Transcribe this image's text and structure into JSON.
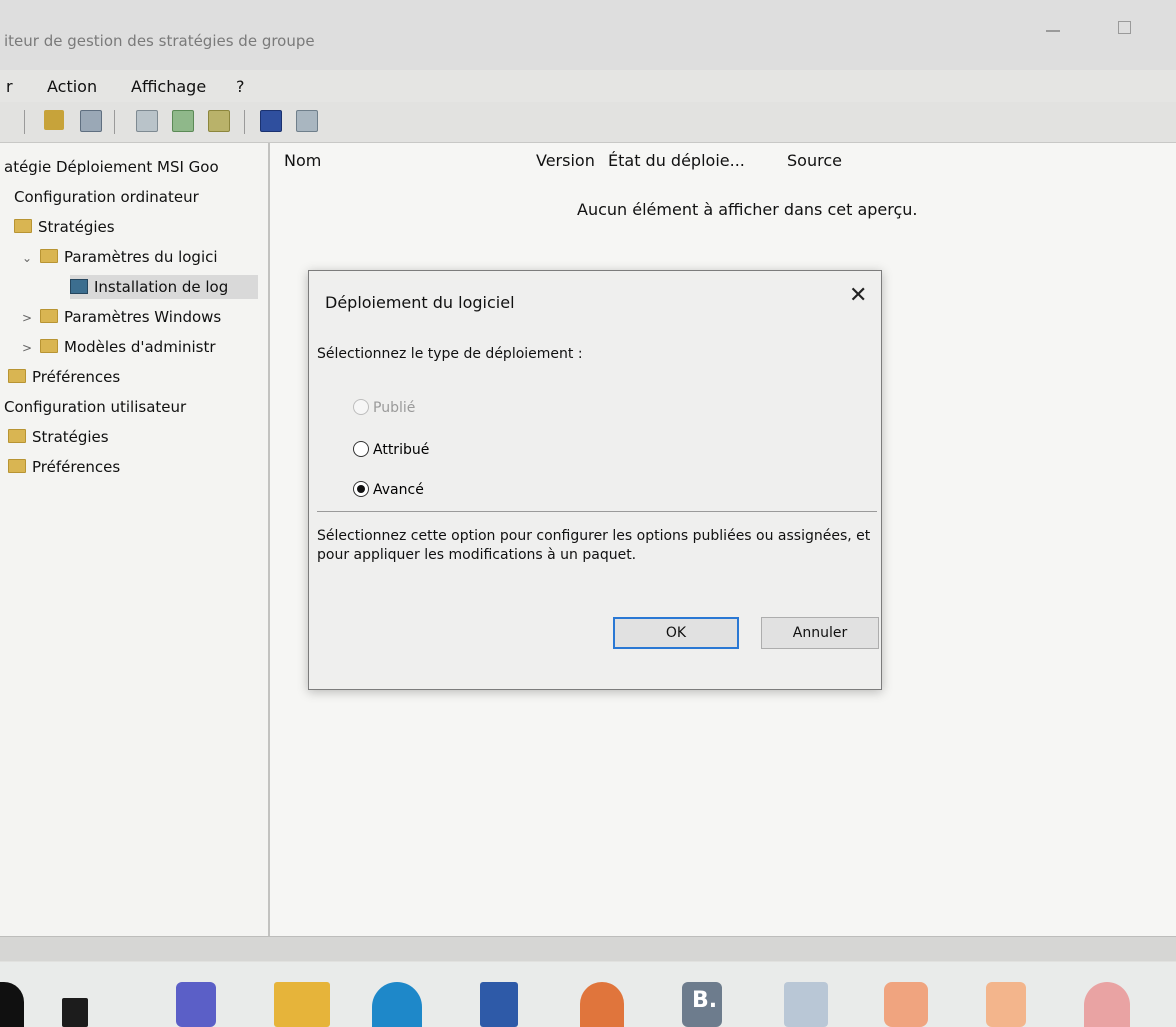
{
  "window": {
    "title": "iteur de gestion des stratégies de groupe"
  },
  "menu": [
    "r",
    "Action",
    "Affichage",
    "?"
  ],
  "tree": {
    "items": [
      {
        "label": "atégie Déploiement MSI Goo",
        "level": 0,
        "icon": "none"
      },
      {
        "label": "Configuration ordinateur",
        "level": 1,
        "icon": "none"
      },
      {
        "label": "Stratégies",
        "level": 2,
        "icon": "folder-icon"
      },
      {
        "label": "Paramètres du logici",
        "level": 3,
        "icon": "folder-icon",
        "expanded": true
      },
      {
        "label": "Installation de log",
        "level": 4,
        "icon": "software-install-icon",
        "selected": true
      },
      {
        "label": "Paramètres Windows",
        "level": 3,
        "icon": "folder-icon",
        "expanded": false
      },
      {
        "label": "Modèles d'administr",
        "level": 3,
        "icon": "folder-icon",
        "expanded": false
      },
      {
        "label": "Préférences",
        "level": 2,
        "icon": "folder-icon"
      },
      {
        "label": "Configuration utilisateur",
        "level": 1,
        "icon": "none"
      },
      {
        "label": "Stratégies",
        "level": 2,
        "icon": "folder-icon"
      },
      {
        "label": "Préférences",
        "level": 2,
        "icon": "folder-icon"
      }
    ],
    "scroll_arrow": ">"
  },
  "list": {
    "columns": [
      "Nom",
      "Version",
      "État du déploie...",
      "Source"
    ],
    "empty_message": "Aucun élément à afficher dans cet aperçu."
  },
  "dialog": {
    "title": "Déploiement du logiciel",
    "close_glyph": "✕",
    "prompt": "Sélectionnez le type de déploiement :",
    "options": [
      {
        "label": "Publié",
        "enabled": false,
        "selected": false
      },
      {
        "label": "Attribué",
        "enabled": true,
        "selected": false
      },
      {
        "label": "Avancé",
        "enabled": true,
        "selected": true
      }
    ],
    "description": "Sélectionnez cette option pour configurer les options publiées ou assignées, et pour appliquer les modifications à un paquet.",
    "ok_label": "OK",
    "cancel_label": "Annuler"
  },
  "taskbar": {
    "apps": [
      "start-icon",
      "task-view-icon",
      "teams-icon",
      "file-explorer-icon",
      "edge-icon",
      "store-icon",
      "firefox-icon",
      "b-app-icon",
      "dropbox-icon",
      "brave-icon",
      "blogger-icon",
      "p-app-icon"
    ],
    "b_label": "B."
  }
}
